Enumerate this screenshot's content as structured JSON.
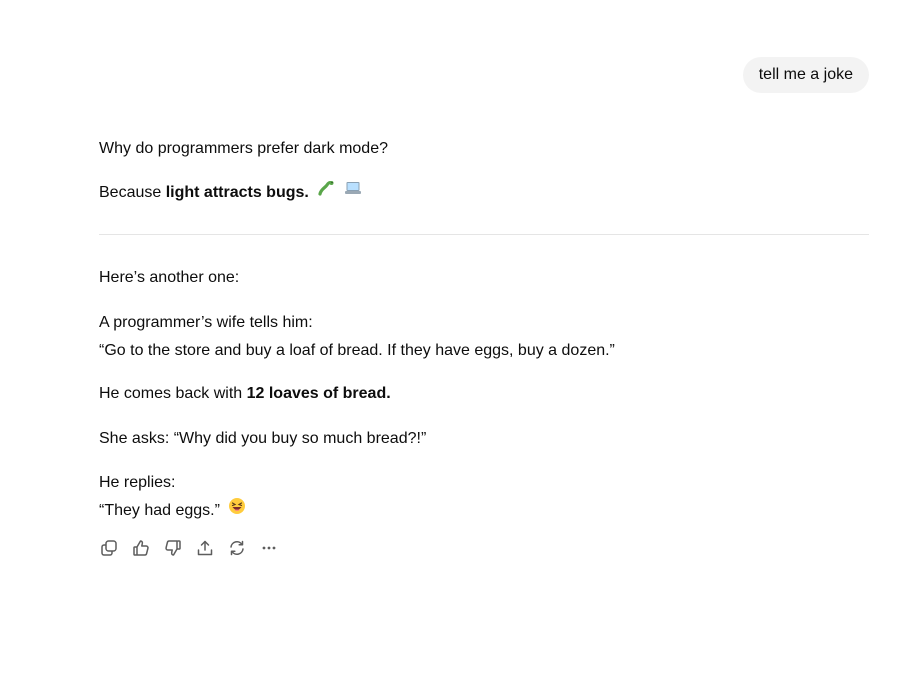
{
  "user_message": "tell me a joke",
  "reply1": {
    "line1": "Why do programmers prefer dark mode?",
    "line2_prefix": "Because ",
    "line2_bold": "light attracts bugs.",
    "emoji_icons": [
      "bug-icon",
      "laptop-icon"
    ]
  },
  "reply2": {
    "intro": "Here’s another one:",
    "p1_line1": "A programmer’s wife tells him:",
    "p1_line2": "“Go to the store and buy a loaf of bread. If they have eggs, buy a dozen.”",
    "p2_prefix": "He comes back with ",
    "p2_bold": "12 loaves of bread.",
    "p3": "She asks: “Why did you buy so much bread?!”",
    "p4_line1": "He replies:",
    "p4_line2": "“They had eggs.”",
    "emoji_icon": "grinning-squinting-face-icon"
  },
  "actions": [
    "copy-icon",
    "thumbs-up-icon",
    "thumbs-down-icon",
    "share-icon",
    "regenerate-icon",
    "more-icon"
  ],
  "colors": {
    "text": "#0d0d0d",
    "bubble_bg": "#f3f3f3",
    "divider": "#e5e5e5",
    "icon": "#5d5d5d"
  }
}
